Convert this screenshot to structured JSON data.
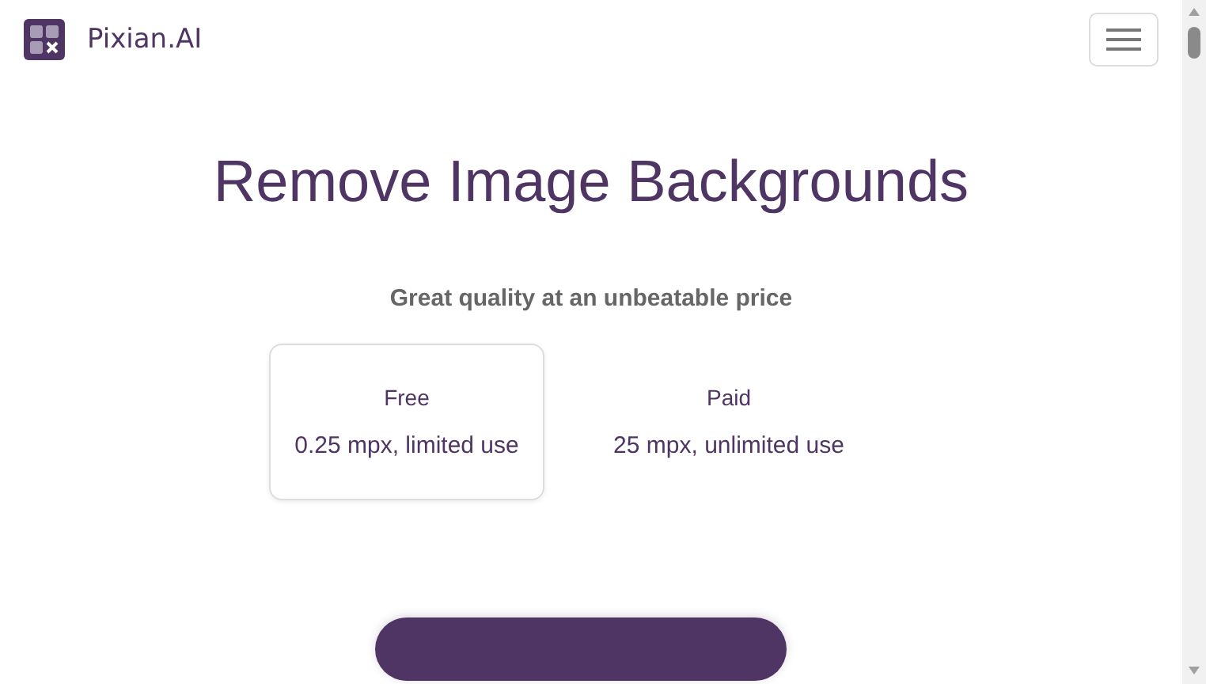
{
  "header": {
    "brand": "Pixian.AI"
  },
  "hero": {
    "title": "Remove Image Backgrounds",
    "subtitle": "Great quality at an unbeatable price"
  },
  "plans": [
    {
      "name": "Free",
      "detail": "0.25 mpx, limited use",
      "selected": true
    },
    {
      "name": "Paid",
      "detail": "25 mpx, unlimited use",
      "selected": false
    }
  ]
}
